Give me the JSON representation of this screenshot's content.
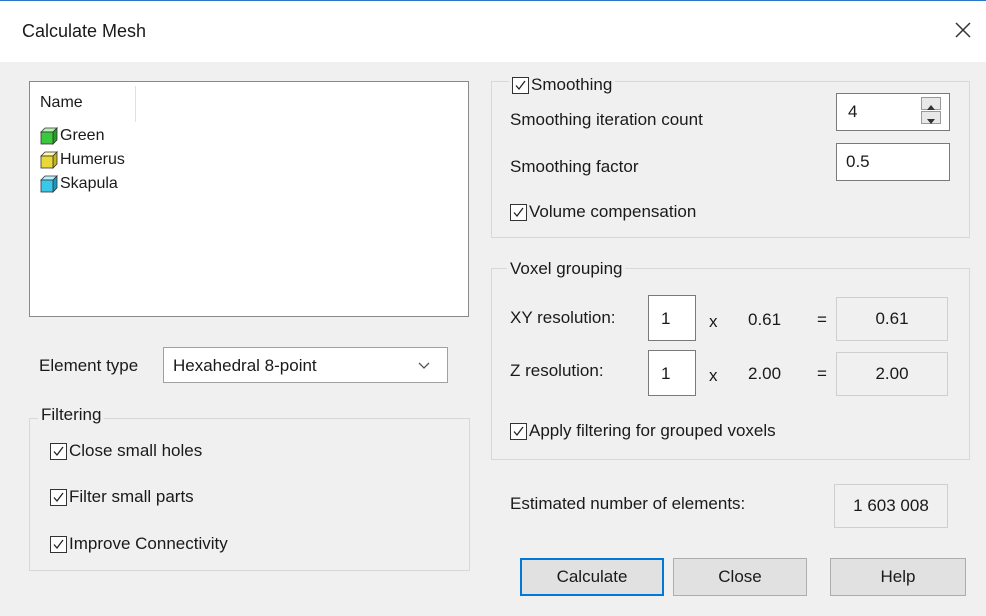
{
  "dialog": {
    "title": "Calculate Mesh"
  },
  "list": {
    "header": "Name",
    "items": [
      {
        "label": "Green",
        "color": "#3cc83c"
      },
      {
        "label": "Humerus",
        "color": "#e8d83a"
      },
      {
        "label": "Skapula",
        "color": "#3ac8e8"
      }
    ]
  },
  "element_type": {
    "label": "Element type",
    "value": "Hexahedral 8-point"
  },
  "filtering": {
    "title": "Filtering",
    "close_small_holes": "Close small holes",
    "filter_small_parts": "Filter small parts",
    "improve_connectivity": "Improve Connectivity"
  },
  "smoothing": {
    "title": "Smoothing",
    "iteration_label": "Smoothing iteration count",
    "iteration_value": "4",
    "factor_label": "Smoothing factor",
    "factor_value": "0.5",
    "volume_compensation": "Volume compensation"
  },
  "voxel": {
    "title": "Voxel grouping",
    "xy_label": "XY resolution:",
    "xy_value": "1",
    "xy_times": "x",
    "xy_size": "0.61",
    "xy_equals": "=",
    "xy_result": "0.61",
    "z_label": "Z resolution:",
    "z_value": "1",
    "z_times": "x",
    "z_size": "2.00",
    "z_equals": "=",
    "z_result": "2.00",
    "apply_filtering": "Apply filtering for grouped voxels"
  },
  "estimate": {
    "label": "Estimated number of elements:",
    "value": "1 603 008"
  },
  "buttons": {
    "calculate": "Calculate",
    "close": "Close",
    "help": "Help"
  },
  "colors": {
    "accent": "#0078d7",
    "window_bg": "#f0f0f0"
  }
}
